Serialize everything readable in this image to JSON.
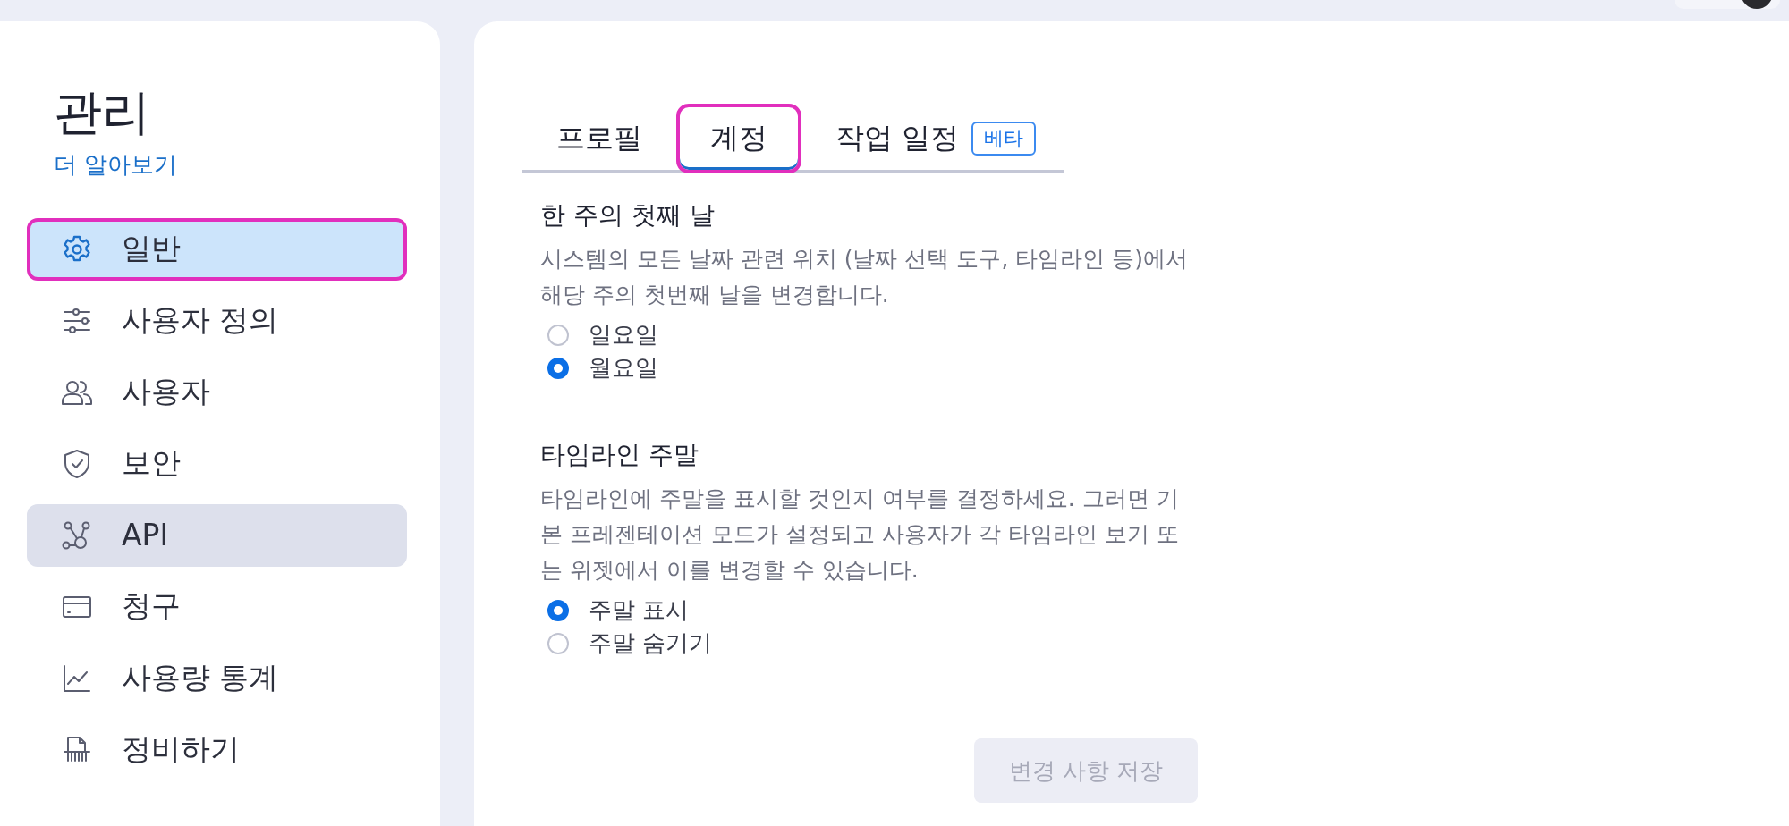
{
  "sidebar": {
    "title": "관리",
    "link": "더 알아보기",
    "items": [
      {
        "label": "일반",
        "selected": true,
        "highlighted": true,
        "hovered": false
      },
      {
        "label": "사용자 정의",
        "selected": false,
        "highlighted": false,
        "hovered": false
      },
      {
        "label": "사용자",
        "selected": false,
        "highlighted": false,
        "hovered": false
      },
      {
        "label": "보안",
        "selected": false,
        "highlighted": false,
        "hovered": false
      },
      {
        "label": "API",
        "selected": false,
        "highlighted": false,
        "hovered": true
      },
      {
        "label": "청구",
        "selected": false,
        "highlighted": false,
        "hovered": false
      },
      {
        "label": "사용량 통계",
        "selected": false,
        "highlighted": false,
        "hovered": false
      },
      {
        "label": "정비하기",
        "selected": false,
        "highlighted": false,
        "hovered": false
      }
    ]
  },
  "tabs": [
    {
      "label": "프로필",
      "selected": false,
      "highlighted": false
    },
    {
      "label": "계정",
      "selected": true,
      "highlighted": true
    },
    {
      "label": "작업 일정",
      "selected": false,
      "highlighted": false,
      "badge": "베타"
    }
  ],
  "sections": [
    {
      "title": "한 주의 첫째 날",
      "description": "시스템의 모든 날짜 관련 위치 (날짜 선택 도구, 타임라인 등)에서 해당 주의 첫번째 날을 변경합니다.",
      "options": [
        {
          "label": "일요일",
          "selected": false
        },
        {
          "label": "월요일",
          "selected": true
        }
      ]
    },
    {
      "title": "타임라인 주말",
      "description": "타임라인에 주말을 표시할 것인지 여부를 결정하세요. 그러면 기본 프레젠테이션 모드가 설정되고 사용자가 각 타임라인 보기 또는 위젯에서 이를 변경할 수 있습니다.",
      "options": [
        {
          "label": "주말 표시",
          "selected": true
        },
        {
          "label": "주말 숨기기",
          "selected": false
        }
      ]
    }
  ],
  "save_button": {
    "label": "변경 사항 저장",
    "disabled": true
  }
}
